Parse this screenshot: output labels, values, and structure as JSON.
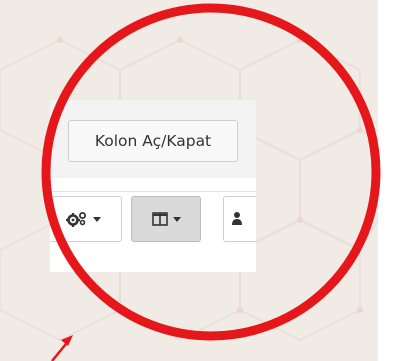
{
  "tooltip": {
    "text": "Kolon Aç/Kapat"
  },
  "toolbar": {
    "settings_button": {
      "icon": "gears-icon"
    },
    "columns_button": {
      "icon": "columns-icon",
      "state": "pressed"
    },
    "third_button": {
      "icon": "users-icon"
    }
  },
  "colors": {
    "highlight_red": "#e5171b",
    "background": "#f1ebe5",
    "pressed_button": "#dadada"
  }
}
